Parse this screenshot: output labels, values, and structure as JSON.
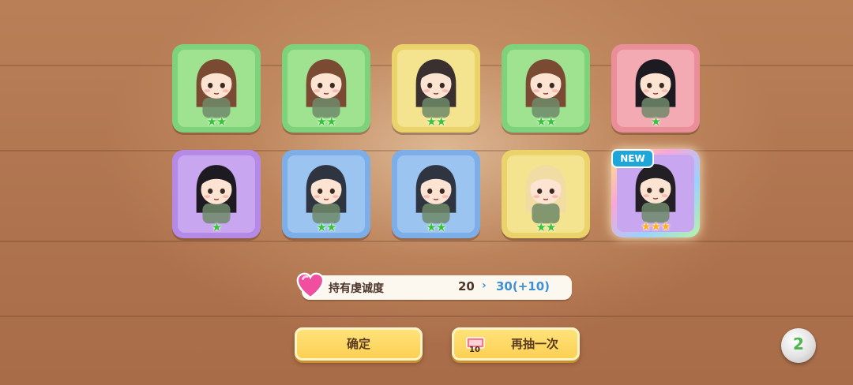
{
  "cards": [
    {
      "color": "green",
      "stars": 2,
      "star_color": "green",
      "character": "headband-girl-wings"
    },
    {
      "color": "green",
      "stars": 2,
      "star_color": "green",
      "character": "headband-girl-wings"
    },
    {
      "color": "yellow",
      "stars": 2,
      "star_color": "green",
      "character": "helmet-soldier-girl"
    },
    {
      "color": "green",
      "stars": 2,
      "star_color": "green",
      "character": "headband-girl-wings"
    },
    {
      "color": "pink",
      "stars": 1,
      "star_color": "green",
      "character": "skull-hat-girl"
    },
    {
      "color": "purple",
      "stars": 1,
      "star_color": "green",
      "character": "skull-hat-girl"
    },
    {
      "color": "blue",
      "stars": 2,
      "star_color": "green",
      "character": "bowl-girl-wings"
    },
    {
      "color": "blue",
      "stars": 2,
      "star_color": "green",
      "character": "bowl-girl-wings"
    },
    {
      "color": "yellow",
      "stars": 2,
      "star_color": "green",
      "character": "blonde-goggles-girl"
    },
    {
      "color": "rainbow",
      "stars": 3,
      "star_color": "gold",
      "character": "glasses-ribbon-girl",
      "is_new": true
    }
  ],
  "new_badge": "NEW",
  "loyalty": {
    "label": "持有虔诚度",
    "current": "20",
    "arrow": "›",
    "next": "30(+10)"
  },
  "buttons": {
    "confirm_label": "确定",
    "redraw_label": "再抽一次",
    "redraw_ticket_count": "10"
  },
  "speed_button_label": "2",
  "icons": {
    "heart": "heart-gem-icon",
    "ticket": "draw-ticket-icon",
    "speed": "speed-toggle-icon"
  }
}
